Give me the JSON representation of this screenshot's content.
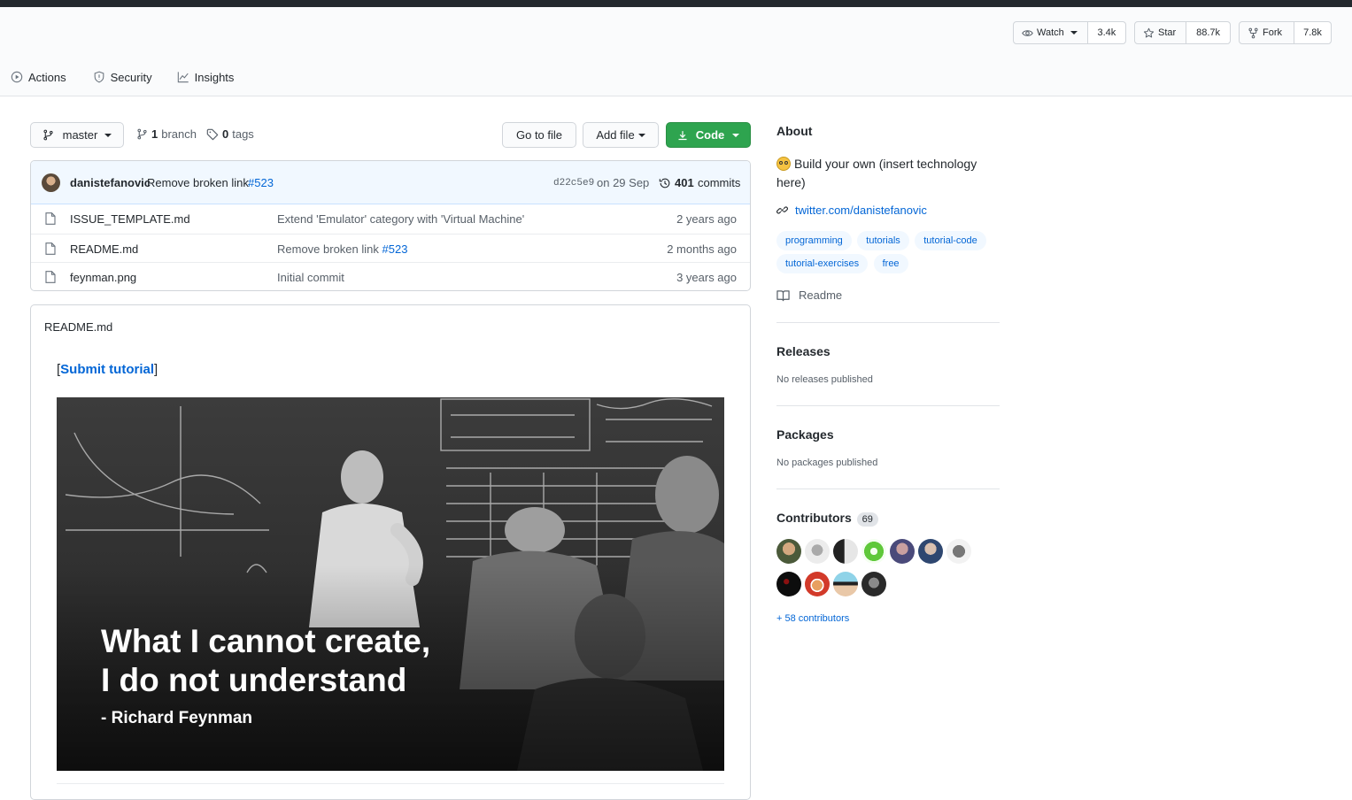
{
  "header": {
    "watch": {
      "label": "Watch",
      "count": "3.4k"
    },
    "star": {
      "label": "Star",
      "count": "88.7k"
    },
    "fork": {
      "label": "Fork",
      "count": "7.8k"
    },
    "tabs": [
      {
        "label": "Actions",
        "icon": "play-icon"
      },
      {
        "label": "Security",
        "icon": "shield-icon"
      },
      {
        "label": "Insights",
        "icon": "graph-icon"
      }
    ]
  },
  "toolbar": {
    "branch": "master",
    "branch_count": "1",
    "branch_label": "branch",
    "tag_count": "0",
    "tag_label": "tags",
    "go_to_file": "Go to file",
    "add_file": "Add file",
    "code": "Code"
  },
  "commit": {
    "author": "danistefanovic",
    "message": "Remove broken link",
    "pr": "#523",
    "sha": "d22c5e9",
    "date": "on 29 Sep",
    "commit_count": "401",
    "commit_label": "commits"
  },
  "files": [
    {
      "name": "ISSUE_TEMPLATE.md",
      "message": "Extend 'Emulator' category with 'Virtual Machine'",
      "pr": "",
      "age": "2 years ago"
    },
    {
      "name": "README.md",
      "message": "Remove broken link",
      "pr": "#523",
      "age": "2 months ago"
    },
    {
      "name": "feynman.png",
      "message": "Initial commit",
      "pr": "",
      "age": "3 years ago"
    }
  ],
  "readme": {
    "title": "README.md",
    "bracket_open": "[",
    "submit_link": "Submit tutorial",
    "bracket_close": "]",
    "image_quote_line1": "What I cannot create,",
    "image_quote_line2": "I do not understand",
    "image_author": "- Richard Feynman"
  },
  "sidebar": {
    "about_title": "About",
    "description": "Build your own (insert technology here)",
    "website": "twitter.com/danistefanovic",
    "topics": [
      "programming",
      "tutorials",
      "tutorial-code",
      "tutorial-exercises",
      "free"
    ],
    "readme_label": "Readme",
    "releases_title": "Releases",
    "releases_text": "No releases published",
    "packages_title": "Packages",
    "packages_text": "No packages published",
    "contributors_title": "Contributors",
    "contributors_count": "69",
    "more_contributors": "+ 58 contributors"
  },
  "colors": {
    "accent_green": "#2ea44f",
    "link_blue": "#0366d6",
    "topic_bg": "#f1f8ff",
    "commit_bar_bg": "#f1f8ff"
  }
}
